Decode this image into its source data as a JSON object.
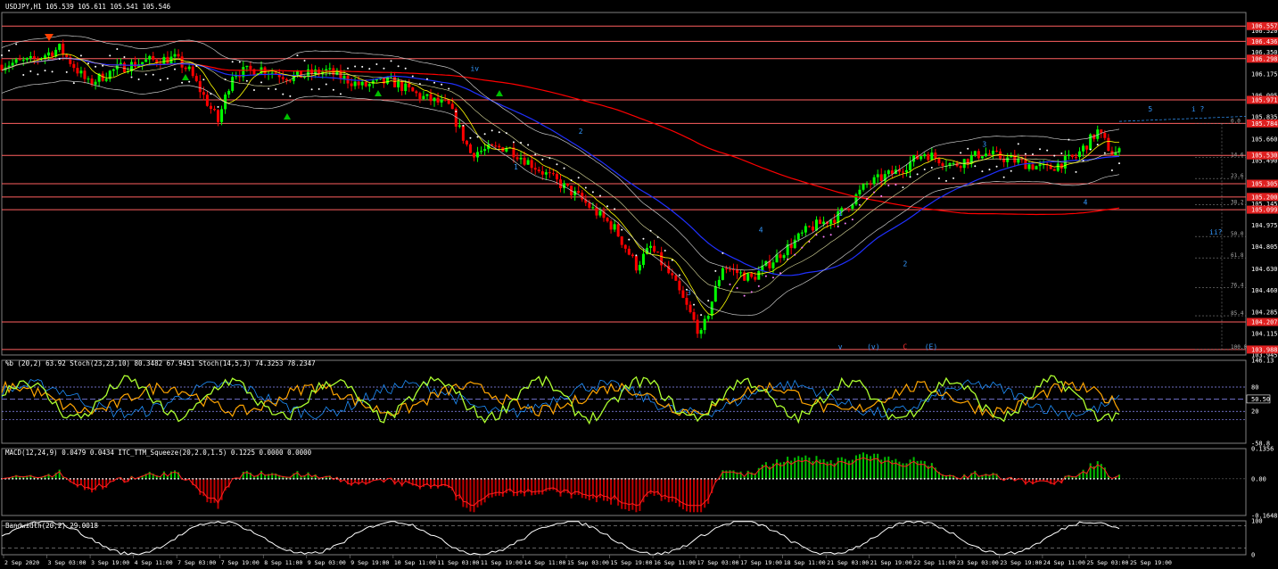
{
  "window": {
    "title": "USDJPY,H1",
    "ohlc": "105.539 105.611 105.541 105.546",
    "symbol_header": "USDJPY,H1 105.539 105.611 105.541 105.546"
  },
  "colors": {
    "background": "#000000",
    "bull": "#00ff00",
    "bear": "#ff0000",
    "hline": "#ff6060",
    "ma_red": "#ff0000",
    "ma_blue": "#2030ff",
    "ma_yellow": "#ffff00",
    "bollinger": "#c8c8c8",
    "psar": "#ffffff",
    "psar_alt": "#ff80ff",
    "wave_label": "#3399ff",
    "stoch_main": "#adff2f",
    "stoch_slow": "#ffa500",
    "pctb": "#1e90ff",
    "macd_signal": "#ff2020",
    "macd_pos": "#00c000",
    "macd_neg": "#c00000"
  },
  "chart_data": [
    {
      "type": "candlestick",
      "panel": "main",
      "symbol": "USDJPY",
      "timeframe": "H1",
      "ylim": [
        103.945,
        106.665
      ],
      "price_ticks": [
        "106.520",
        "106.350",
        "106.175",
        "106.005",
        "105.835",
        "105.660",
        "105.490",
        "105.320",
        "105.145",
        "104.975",
        "104.805",
        "104.630",
        "104.460",
        "104.285",
        "104.115",
        "103.945"
      ],
      "highlighted_levels": [
        {
          "value": 106.557,
          "label": "106.557"
        },
        {
          "value": 106.436,
          "label": "106.436"
        },
        {
          "value": 106.298,
          "label": "106.298"
        },
        {
          "value": 105.971,
          "label": "105.971"
        },
        {
          "value": 105.784,
          "label": "105.784"
        },
        {
          "value": 105.53,
          "label": "105.530"
        },
        {
          "value": 105.305,
          "label": "105.305"
        },
        {
          "value": 105.2,
          "label": "105.200"
        },
        {
          "value": 105.099,
          "label": "105.099"
        },
        {
          "value": 104.207,
          "label": "104.207"
        },
        {
          "value": 103.988,
          "label": "103.988"
        }
      ],
      "fibonacci_levels": [
        {
          "value": 105.784,
          "label": "0.0"
        },
        {
          "value": 105.514,
          "label": "14.6"
        },
        {
          "value": 105.346,
          "label": "23.6"
        },
        {
          "value": 105.138,
          "label": "38.2"
        },
        {
          "value": 104.886,
          "label": "50.0"
        },
        {
          "value": 104.716,
          "label": "61.8"
        },
        {
          "value": 104.479,
          "label": "76.4"
        },
        {
          "value": 104.256,
          "label": "85.4"
        },
        {
          "value": 103.988,
          "label": "100.0"
        }
      ],
      "series": [
        {
          "name": "close_path",
          "x": [
            0,
            8,
            16,
            24,
            32,
            40,
            48,
            52,
            56,
            60,
            64,
            72,
            80,
            90,
            100,
            108,
            116,
            124,
            130,
            140,
            150,
            160,
            170,
            176,
            180,
            186,
            194,
            200,
            208,
            216,
            224
          ],
          "y": [
            106.25,
            106.28,
            106.38,
            106.1,
            106.22,
            106.28,
            106.3,
            106.2,
            106.0,
            105.8,
            106.18,
            106.22,
            106.15,
            106.2,
            106.08,
            106.12,
            106.0,
            105.92,
            105.55,
            105.6,
            105.4,
            105.2,
            104.95,
            104.65,
            104.8,
            104.55,
            104.1,
            104.65,
            104.55,
            104.75,
            104.95
          ]
        },
        {
          "name": "continuation",
          "x": [
            224,
            232,
            240,
            248,
            256,
            264,
            272,
            282,
            290,
            298,
            304,
            308
          ],
          "y": [
            104.95,
            105.05,
            105.3,
            105.4,
            105.55,
            105.45,
            105.55,
            105.48,
            105.42,
            105.52,
            105.72,
            105.55
          ]
        }
      ],
      "wave_labels": [
        "iv",
        "2",
        "1",
        "4",
        "3",
        "1",
        "2",
        "3",
        "4",
        "5",
        "i ?",
        "ii?",
        "v",
        "(v)",
        "C",
        "(E)"
      ],
      "x_labels": [
        "2 Sep 2020",
        "3 Sep 03:00",
        "3 Sep 19:00",
        "4 Sep 11:00",
        "7 Sep 03:00",
        "7 Sep 19:00",
        "8 Sep 11:00",
        "9 Sep 03:00",
        "9 Sep 19:00",
        "10 Sep 11:00",
        "11 Sep 03:00",
        "11 Sep 19:00",
        "14 Sep 11:00",
        "15 Sep 03:00",
        "15 Sep 19:00",
        "16 Sep 11:00",
        "17 Sep 03:00",
        "17 Sep 19:00",
        "18 Sep 11:00",
        "21 Sep 03:00",
        "21 Sep 19:00",
        "22 Sep 11:00",
        "23 Sep 03:00",
        "23 Sep 19:00",
        "24 Sep 11:00",
        "25 Sep 03:00",
        "25 Sep 19:00"
      ]
    },
    {
      "type": "line",
      "panel": "oscillator",
      "header": "%b (20,2) 63.92  Stoch(23,23,10) 80.3482 67.9451  Stoch(14,5,3) 74.3253 78.2347",
      "ticks": [
        "146.13",
        "80",
        "50.50",
        "20",
        "-58.8"
      ],
      "ylim": [
        -58.8,
        146.13
      ],
      "levels": [
        80,
        50,
        20,
        0
      ]
    },
    {
      "type": "bar",
      "panel": "macd",
      "header": "MACD(12,24,9) 0.0479 0.0434  ITC_TTM_Squeeze(20,2.0,1.5) 0.1225 0.0000 0.0000",
      "ticks": [
        "0.1356",
        "0.00",
        "-0.1648"
      ],
      "ylim": [
        -0.1648,
        0.1356
      ]
    },
    {
      "type": "line",
      "panel": "bandwidth",
      "header": "Bandwidth(20,2) 29.0018",
      "ticks": [
        "100",
        "0"
      ],
      "ylim": [
        0,
        100
      ]
    }
  ]
}
